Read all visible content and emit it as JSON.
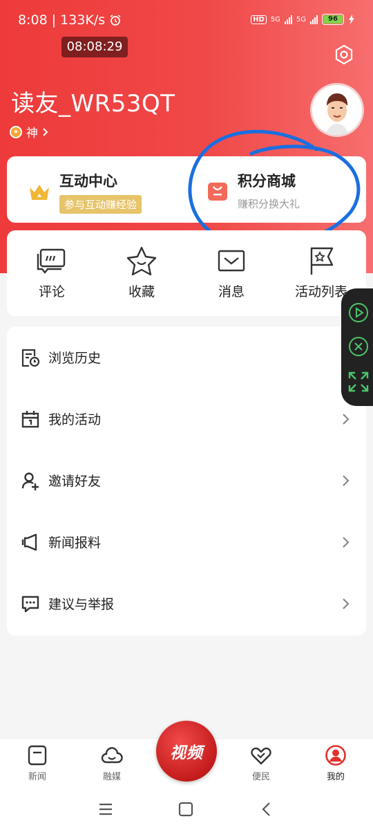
{
  "status_bar": {
    "time_speed": "8:08 | 133K/s",
    "alarm_icon": "alarm-icon",
    "hd": "HD",
    "net1": "5G",
    "net2": "5G",
    "battery": "96",
    "timer": "08:08:29"
  },
  "profile": {
    "username": "读友_WR53QT",
    "level": "神",
    "settings_icon": "settings-hexagon-icon",
    "avatar_icon": "cartoon-avatar"
  },
  "interact_card": {
    "left_title": "互动中心",
    "left_badge": "参与互动赚经验",
    "right_title": "积分商城",
    "right_sub": "赚积分换大礼"
  },
  "quick_links": [
    {
      "label": "评论",
      "icon": "comment-icon"
    },
    {
      "label": "收藏",
      "icon": "star-icon"
    },
    {
      "label": "消息",
      "icon": "mail-icon"
    },
    {
      "label": "活动列表",
      "icon": "flag-icon"
    }
  ],
  "menu": [
    {
      "label": "浏览历史",
      "icon": "history-icon"
    },
    {
      "label": "我的活动",
      "icon": "calendar-icon"
    },
    {
      "label": "邀请好友",
      "icon": "invite-user-icon"
    },
    {
      "label": "新闻报料",
      "icon": "news-tip-icon"
    },
    {
      "label": "建议与举报",
      "icon": "feedback-icon"
    }
  ],
  "bottom_nav": [
    {
      "label": "新闻",
      "icon": "news-icon"
    },
    {
      "label": "融媒",
      "icon": "cloud-icon"
    },
    {
      "label": "视频",
      "icon": "video-icon"
    },
    {
      "label": "便民",
      "icon": "handshake-icon"
    },
    {
      "label": "我的",
      "icon": "user-icon"
    }
  ],
  "colors": {
    "header_red": "#ee3a3a",
    "accent_gold": "#e7c46a",
    "annotation_blue": "#1a6fe0"
  }
}
